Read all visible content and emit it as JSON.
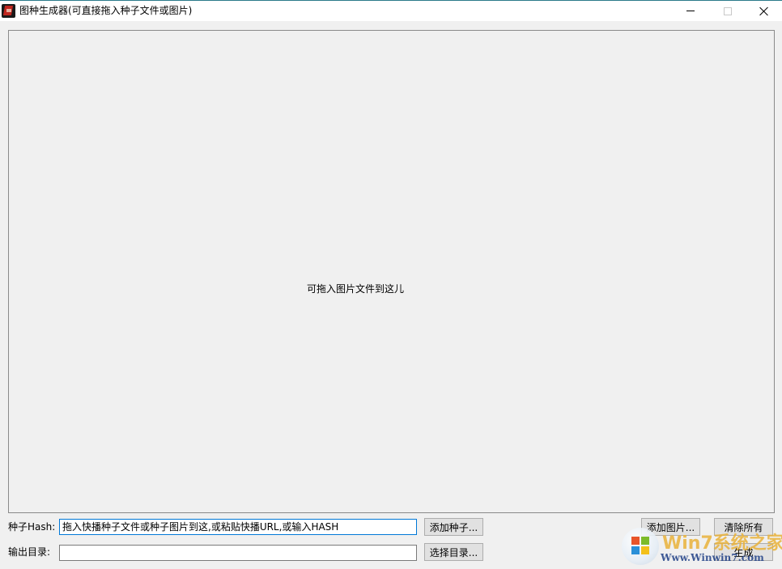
{
  "window": {
    "title": "图种生成器(可直接拖入种子文件或图片)",
    "icon": "app-icon",
    "controls": [
      "minimize-icon",
      "maximize-icon",
      "close-icon"
    ]
  },
  "drop_area": {
    "hint": "可拖入图片文件到这儿"
  },
  "form": {
    "hash_label": "种子Hash:",
    "hash_value": "拖入快播种子文件或种子图片到这,或粘贴快播URL,或输入HASH",
    "output_label": "输出目录:",
    "output_value": ""
  },
  "buttons": {
    "add_torrent": "添加种子...",
    "choose_dir": "选择目录...",
    "add_image": "添加图片...",
    "clear_all": "清除所有",
    "generate": "生成"
  },
  "watermark": {
    "title": "Win7系统之家",
    "url": "Www.Winwin7.com"
  }
}
